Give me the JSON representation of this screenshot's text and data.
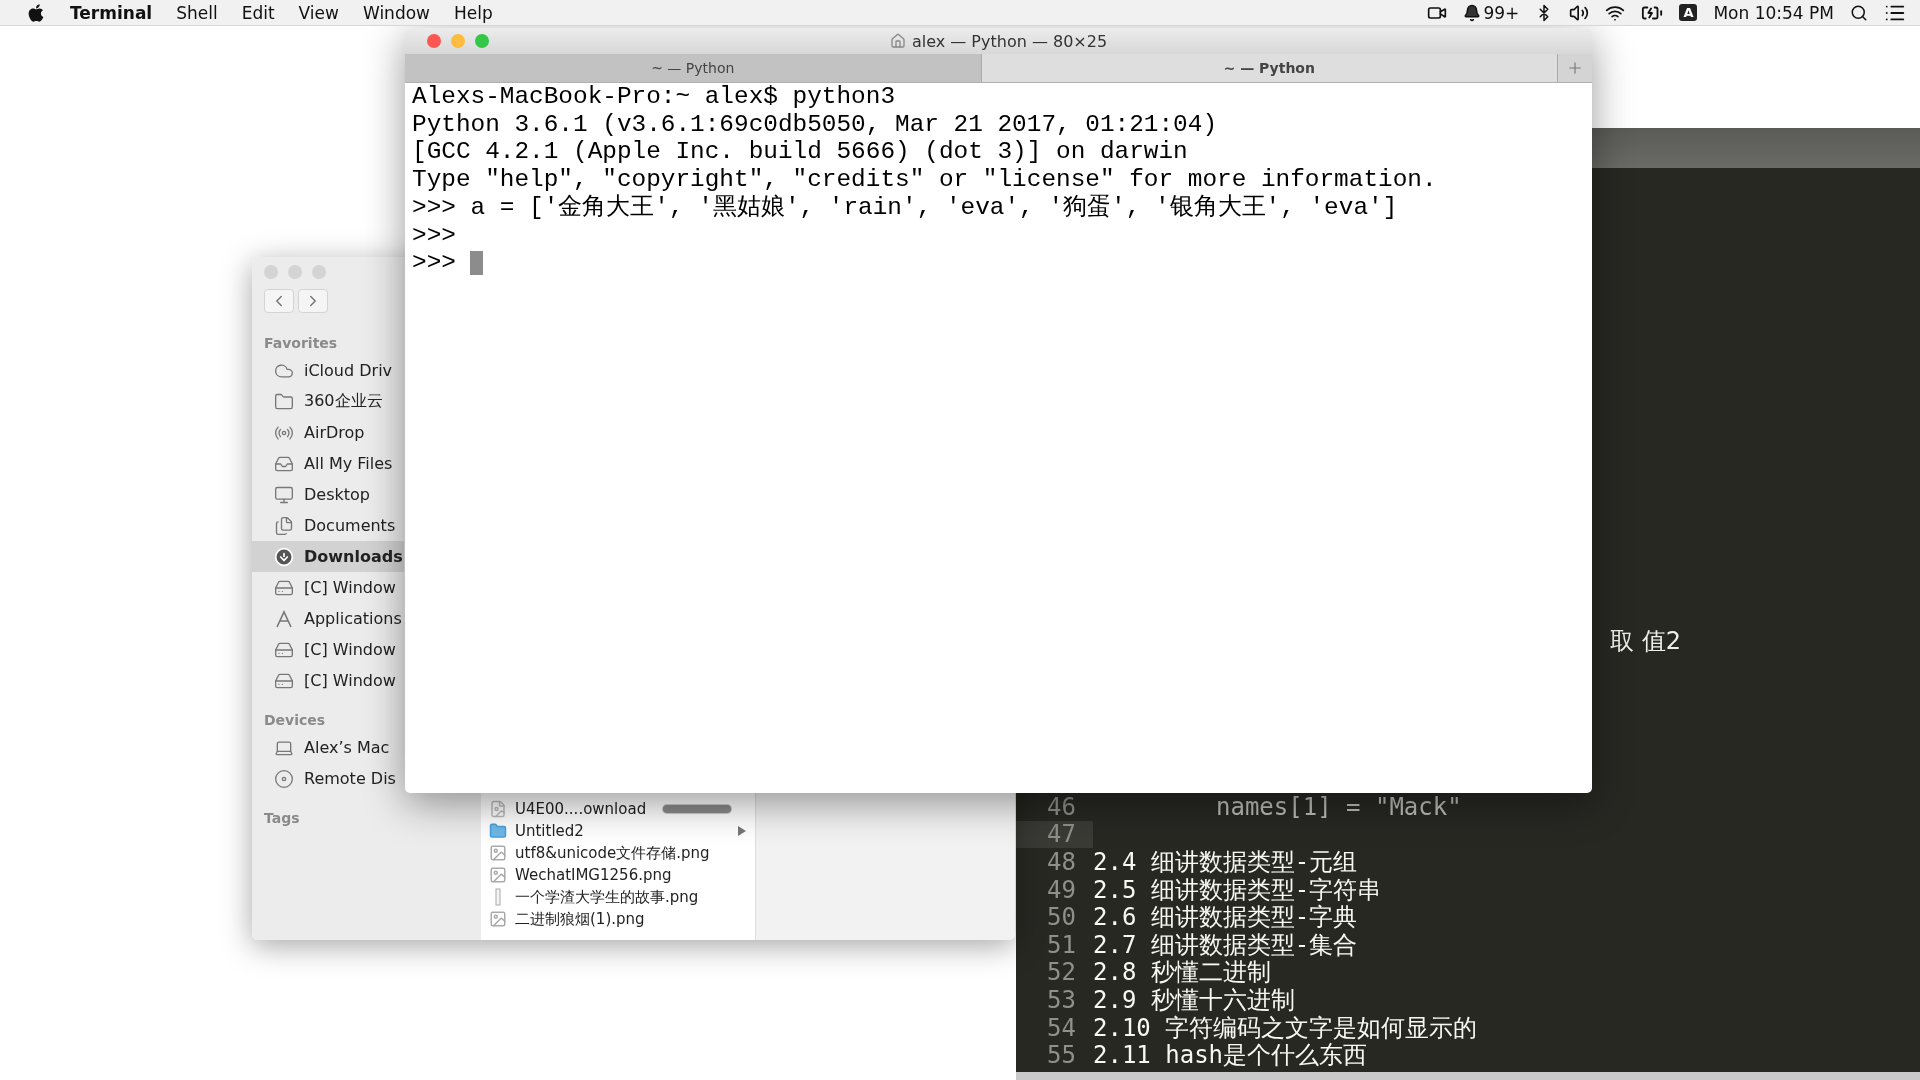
{
  "menu_bar": {
    "app": "Terminal",
    "menus": [
      "Shell",
      "Edit",
      "View",
      "Window",
      "Help"
    ],
    "notification_count": "99+",
    "input_source": "A",
    "clock": "Mon 10:54 PM"
  },
  "finder": {
    "sections": [
      {
        "title": "Favorites",
        "items": [
          {
            "label": "iCloud Driv",
            "kind": "cloud",
            "selected": false
          },
          {
            "label": "360企业云",
            "kind": "folder",
            "selected": false
          },
          {
            "label": "AirDrop",
            "kind": "airdrop",
            "selected": false
          },
          {
            "label": "All My Files",
            "kind": "files",
            "selected": false
          },
          {
            "label": "Desktop",
            "kind": "desktop",
            "selected": false
          },
          {
            "label": "Documents",
            "kind": "documents",
            "selected": false
          },
          {
            "label": "Downloads",
            "kind": "downloads",
            "selected": true
          },
          {
            "label": "[C] Window",
            "kind": "drive",
            "selected": false
          },
          {
            "label": "Applications",
            "kind": "apps",
            "selected": false
          },
          {
            "label": "[C] Window",
            "kind": "drive",
            "selected": false
          },
          {
            "label": "[C] Window",
            "kind": "drive",
            "selected": false
          }
        ]
      },
      {
        "title": "Devices",
        "items": [
          {
            "label": "Alex’s Mac",
            "kind": "laptop",
            "selected": false
          },
          {
            "label": "Remote Dis",
            "kind": "disc",
            "selected": false
          }
        ]
      },
      {
        "title": "Tags"
      }
    ],
    "files": [
      {
        "name": "U4E00....ownload",
        "kind": "download",
        "level": 1
      },
      {
        "name": "Untitled2",
        "kind": "folder"
      },
      {
        "name": "utf8&unicode文件存储.png",
        "kind": "image"
      },
      {
        "name": "WechatIMG1256.png",
        "kind": "image"
      },
      {
        "name": "一个学渣大学生的故事.png",
        "kind": "tall-image"
      },
      {
        "name": "二进制狼烟(1).png",
        "kind": "image"
      }
    ]
  },
  "terminal": {
    "title": "alex — Python — 80×25",
    "tabs": [
      {
        "label": "~ — Python",
        "selected": false
      },
      {
        "label": "~ — Python",
        "selected": true
      }
    ],
    "lines": [
      "Alexs-MacBook-Pro:~ alex$ python3",
      "Python 3.6.1 (v3.6.1:69c0db5050, Mar 21 2017, 01:21:04)",
      "[GCC 4.2.1 (Apple Inc. build 5666) (dot 3)] on darwin",
      "Type \"help\", \"copyright\", \"credits\" or \"license\" for more information.",
      ">>> a = ['金角大王', '黑姑娘', 'rain', 'eva', '狗蛋', '银角大王', 'eva']",
      ">>>",
      ">>>"
    ]
  },
  "editor": {
    "fragment": "取 值2",
    "lines": [
      {
        "number": "46",
        "kind": "code",
        "text": "names[1] = \"Mack\"",
        "current": false
      },
      {
        "number": "47",
        "kind": "blank",
        "current": true
      },
      {
        "number": "48",
        "kind": "heading",
        "text": "2.4 细讲数据类型-元组",
        "current": false
      },
      {
        "number": "49",
        "kind": "heading",
        "text": "2.5 细讲数据类型-字符串",
        "current": false
      },
      {
        "number": "50",
        "kind": "heading",
        "text": "2.6 细讲数据类型-字典",
        "current": false
      },
      {
        "number": "51",
        "kind": "heading",
        "text": "2.7 细讲数据类型-集合",
        "current": false
      },
      {
        "number": "52",
        "kind": "heading",
        "text": "2.8 秒懂二进制",
        "current": false
      },
      {
        "number": "53",
        "kind": "heading",
        "text": "2.9 秒懂十六进制",
        "current": false
      },
      {
        "number": "54",
        "kind": "heading",
        "text": "2.10 字符编码之文字是如何显示的",
        "current": false
      },
      {
        "number": "55",
        "kind": "heading",
        "text": "2.11 hash是个什么东西",
        "current": false
      }
    ]
  }
}
